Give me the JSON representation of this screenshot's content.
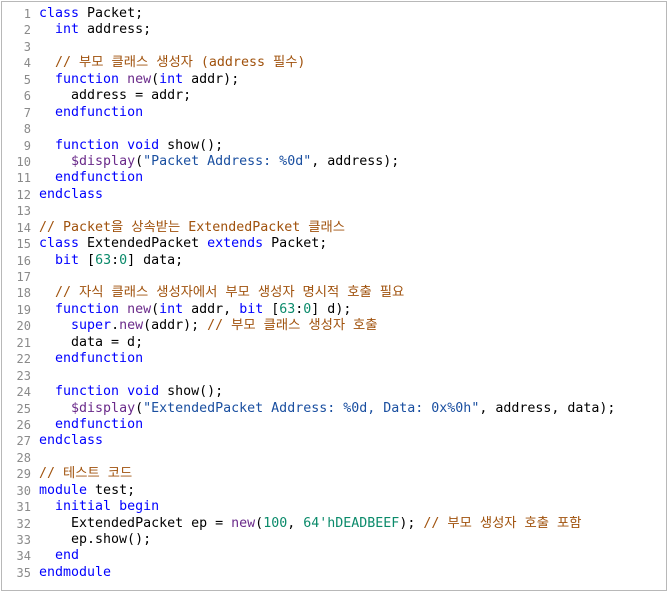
{
  "editor": {
    "lines": [
      {
        "n": "1",
        "tokens": [
          {
            "t": "class",
            "c": "kw"
          },
          {
            "t": " Packet;",
            "c": "plain"
          }
        ]
      },
      {
        "n": "2",
        "tokens": [
          {
            "t": "  ",
            "c": "plain"
          },
          {
            "t": "int",
            "c": "kw"
          },
          {
            "t": " address;",
            "c": "plain"
          }
        ]
      },
      {
        "n": "3",
        "tokens": []
      },
      {
        "n": "4",
        "tokens": [
          {
            "t": "  ",
            "c": "plain"
          },
          {
            "t": "// 부모 클래스 생성자 (address 필수)",
            "c": "cm"
          }
        ]
      },
      {
        "n": "5",
        "tokens": [
          {
            "t": "  ",
            "c": "plain"
          },
          {
            "t": "function",
            "c": "kw"
          },
          {
            "t": " ",
            "c": "plain"
          },
          {
            "t": "new",
            "c": "fn"
          },
          {
            "t": "(",
            "c": "plain"
          },
          {
            "t": "int",
            "c": "kw"
          },
          {
            "t": " addr);",
            "c": "plain"
          }
        ]
      },
      {
        "n": "6",
        "tokens": [
          {
            "t": "    address = addr;",
            "c": "plain"
          }
        ]
      },
      {
        "n": "7",
        "tokens": [
          {
            "t": "  ",
            "c": "plain"
          },
          {
            "t": "endfunction",
            "c": "kw"
          }
        ]
      },
      {
        "n": "8",
        "tokens": []
      },
      {
        "n": "9",
        "tokens": [
          {
            "t": "  ",
            "c": "plain"
          },
          {
            "t": "function",
            "c": "kw"
          },
          {
            "t": " ",
            "c": "plain"
          },
          {
            "t": "void",
            "c": "kw"
          },
          {
            "t": " show();",
            "c": "plain"
          }
        ]
      },
      {
        "n": "10",
        "tokens": [
          {
            "t": "    ",
            "c": "plain"
          },
          {
            "t": "$display",
            "c": "sys"
          },
          {
            "t": "(",
            "c": "plain"
          },
          {
            "t": "\"Packet Address: %0d\"",
            "c": "str"
          },
          {
            "t": ", address);",
            "c": "plain"
          }
        ]
      },
      {
        "n": "11",
        "tokens": [
          {
            "t": "  ",
            "c": "plain"
          },
          {
            "t": "endfunction",
            "c": "kw"
          }
        ]
      },
      {
        "n": "12",
        "tokens": [
          {
            "t": "endclass",
            "c": "kw"
          }
        ]
      },
      {
        "n": "13",
        "tokens": []
      },
      {
        "n": "14",
        "tokens": [
          {
            "t": "// Packet을 상속받는 ExtendedPacket 클래스",
            "c": "cm"
          }
        ]
      },
      {
        "n": "15",
        "tokens": [
          {
            "t": "class",
            "c": "kw"
          },
          {
            "t": " ExtendedPacket ",
            "c": "plain"
          },
          {
            "t": "extends",
            "c": "kw"
          },
          {
            "t": " Packet;",
            "c": "plain"
          }
        ]
      },
      {
        "n": "16",
        "tokens": [
          {
            "t": "  ",
            "c": "plain"
          },
          {
            "t": "bit",
            "c": "kw"
          },
          {
            "t": " [",
            "c": "plain"
          },
          {
            "t": "63",
            "c": "num"
          },
          {
            "t": ":",
            "c": "plain"
          },
          {
            "t": "0",
            "c": "num"
          },
          {
            "t": "] data;",
            "c": "plain"
          }
        ]
      },
      {
        "n": "17",
        "tokens": []
      },
      {
        "n": "18",
        "tokens": [
          {
            "t": "  ",
            "c": "plain"
          },
          {
            "t": "// 자식 클래스 생성자에서 부모 생성자 명시적 호출 필요",
            "c": "cm"
          }
        ]
      },
      {
        "n": "19",
        "tokens": [
          {
            "t": "  ",
            "c": "plain"
          },
          {
            "t": "function",
            "c": "kw"
          },
          {
            "t": " ",
            "c": "plain"
          },
          {
            "t": "new",
            "c": "fn"
          },
          {
            "t": "(",
            "c": "plain"
          },
          {
            "t": "int",
            "c": "kw"
          },
          {
            "t": " addr, ",
            "c": "plain"
          },
          {
            "t": "bit",
            "c": "kw"
          },
          {
            "t": " [",
            "c": "plain"
          },
          {
            "t": "63",
            "c": "num"
          },
          {
            "t": ":",
            "c": "plain"
          },
          {
            "t": "0",
            "c": "num"
          },
          {
            "t": "] d);",
            "c": "plain"
          }
        ]
      },
      {
        "n": "20",
        "tokens": [
          {
            "t": "    ",
            "c": "plain"
          },
          {
            "t": "super",
            "c": "kw"
          },
          {
            "t": ".",
            "c": "plain"
          },
          {
            "t": "new",
            "c": "fn"
          },
          {
            "t": "(addr); ",
            "c": "plain"
          },
          {
            "t": "// 부모 클래스 생성자 호출",
            "c": "cm"
          }
        ]
      },
      {
        "n": "21",
        "tokens": [
          {
            "t": "    data = d;",
            "c": "plain"
          }
        ]
      },
      {
        "n": "22",
        "tokens": [
          {
            "t": "  ",
            "c": "plain"
          },
          {
            "t": "endfunction",
            "c": "kw"
          }
        ]
      },
      {
        "n": "23",
        "tokens": []
      },
      {
        "n": "24",
        "tokens": [
          {
            "t": "  ",
            "c": "plain"
          },
          {
            "t": "function",
            "c": "kw"
          },
          {
            "t": " ",
            "c": "plain"
          },
          {
            "t": "void",
            "c": "kw"
          },
          {
            "t": " show();",
            "c": "plain"
          }
        ]
      },
      {
        "n": "25",
        "tokens": [
          {
            "t": "    ",
            "c": "plain"
          },
          {
            "t": "$display",
            "c": "sys"
          },
          {
            "t": "(",
            "c": "plain"
          },
          {
            "t": "\"ExtendedPacket Address: %0d, Data: 0x%0h\"",
            "c": "str"
          },
          {
            "t": ", address, data);",
            "c": "plain"
          }
        ]
      },
      {
        "n": "26",
        "tokens": [
          {
            "t": "  ",
            "c": "plain"
          },
          {
            "t": "endfunction",
            "c": "kw"
          }
        ]
      },
      {
        "n": "27",
        "tokens": [
          {
            "t": "endclass",
            "c": "kw"
          }
        ]
      },
      {
        "n": "28",
        "tokens": []
      },
      {
        "n": "29",
        "tokens": [
          {
            "t": "// 테스트 코드",
            "c": "cm"
          }
        ]
      },
      {
        "n": "30",
        "tokens": [
          {
            "t": "module",
            "c": "kw"
          },
          {
            "t": " test;",
            "c": "plain"
          }
        ]
      },
      {
        "n": "31",
        "tokens": [
          {
            "t": "  ",
            "c": "plain"
          },
          {
            "t": "initial",
            "c": "kw"
          },
          {
            "t": " ",
            "c": "plain"
          },
          {
            "t": "begin",
            "c": "kw"
          }
        ]
      },
      {
        "n": "32",
        "tokens": [
          {
            "t": "    ExtendedPacket ep = ",
            "c": "plain"
          },
          {
            "t": "new",
            "c": "fn"
          },
          {
            "t": "(",
            "c": "plain"
          },
          {
            "t": "100",
            "c": "num"
          },
          {
            "t": ", ",
            "c": "plain"
          },
          {
            "t": "64'hDEADBEEF",
            "c": "num"
          },
          {
            "t": "); ",
            "c": "plain"
          },
          {
            "t": "// 부모 생성자 호출 포함",
            "c": "cm"
          }
        ]
      },
      {
        "n": "33",
        "tokens": [
          {
            "t": "    ep.show();",
            "c": "plain"
          }
        ]
      },
      {
        "n": "34",
        "tokens": [
          {
            "t": "  ",
            "c": "plain"
          },
          {
            "t": "end",
            "c": "kw"
          }
        ]
      },
      {
        "n": "35",
        "tokens": [
          {
            "t": "endmodule",
            "c": "kw"
          }
        ]
      }
    ]
  },
  "colors": {
    "keyword": "#0000ff",
    "comment": "#a0520d",
    "string": "#1a4fa0",
    "number": "#0a8a6a",
    "function": "#6a2a8a",
    "line_number": "#8a8a8a",
    "border": "#b8b8b8"
  }
}
